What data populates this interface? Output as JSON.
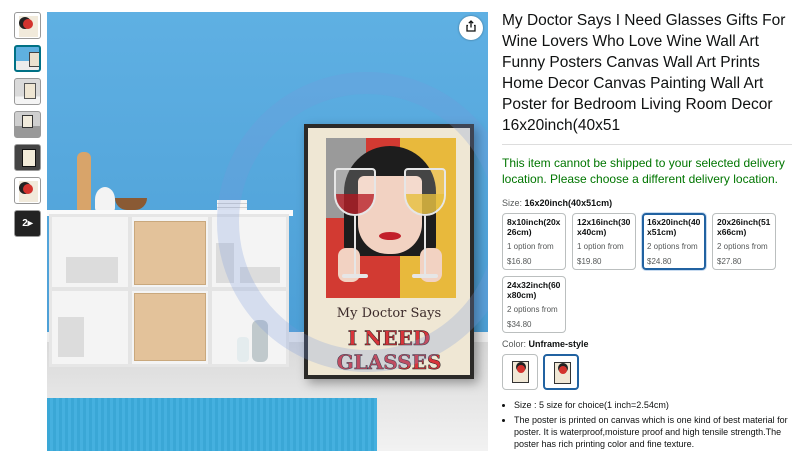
{
  "thumbnails": [
    {
      "kind": "poster"
    },
    {
      "kind": "room",
      "active": true
    },
    {
      "kind": "room2"
    },
    {
      "kind": "room3"
    },
    {
      "kind": "dark"
    },
    {
      "kind": "poster"
    },
    {
      "kind": "video",
      "label": "2▸"
    }
  ],
  "poster": {
    "line1": "My Doctor Says",
    "line2": "I NEED GLASSES"
  },
  "product": {
    "title": "My Doctor Says I Need Glasses Gifts For Wine Lovers Who Love Wine Wall Art Funny Posters Canvas Wall Art Prints Home Decor Canvas Painting Wall Art Poster for Bedroom Living Room Decor 16x20inch(40x51",
    "shipping_warning": "This item cannot be shipped to your selected delivery location. Please choose a different delivery location."
  },
  "size": {
    "label": "Size:",
    "selected": "16x20inch(40x51cm)",
    "options": [
      {
        "name": "8x10inch(20x26cm)",
        "options": "1 option from",
        "price": "$16.80",
        "selected": false
      },
      {
        "name": "12x16inch(30x40cm)",
        "options": "1 option from",
        "price": "$19.80",
        "selected": false
      },
      {
        "name": "16x20inch(40x51cm)",
        "options": "2 options from",
        "price": "$24.80",
        "selected": true
      },
      {
        "name": "20x26inch(51x66cm)",
        "options": "2 options from",
        "price": "$27.80",
        "selected": false
      },
      {
        "name": "24x32inch(60x80cm)",
        "options": "2 options from",
        "price": "$34.80",
        "selected": false
      }
    ]
  },
  "color": {
    "label": "Color:",
    "selected": "Unframe-style",
    "swatches": [
      {
        "selected": false
      },
      {
        "selected": true
      }
    ]
  },
  "bullets": [
    "Size : 5 size for choice(1 inch=2.54cm)",
    "The poster is printed on canvas which is one kind of best material for poster. It is waterproof,moisture proof and high tensile strength.The poster has rich printing color and fine texture."
  ],
  "icons": {
    "share": "share-icon"
  },
  "colors": {
    "link_blue": "#2162a1",
    "ship_green": "#007600",
    "wall_blue": "#5fb0e3"
  }
}
